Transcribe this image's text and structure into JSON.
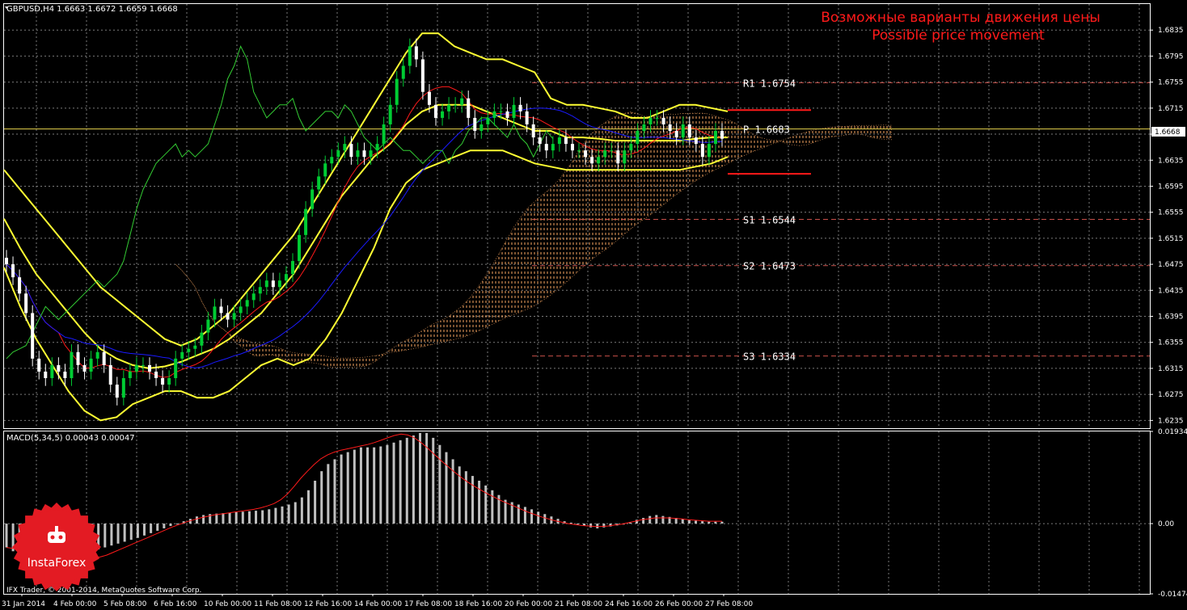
{
  "window": {
    "title": "GBPUSD,H4  1.6663 1.6672 1.6659 1.6668",
    "footer": "IFX Trader, © 2001-2014, MetaQuotes Software Corp."
  },
  "logo": {
    "text": "InstaForex"
  },
  "annotation": {
    "line1": "Возможные варианты движения цены",
    "line2": "Possible price movement",
    "color": "#ff1a1a"
  },
  "colors": {
    "background": "#000000",
    "grid": "#7a7a7a",
    "axis": "#ffffff",
    "candle_up": "#00cc33",
    "candle_down": "#ffffff",
    "bollinger": "#ffff33",
    "tenkan": "#ff1a1a",
    "kijun": "#1a1aff",
    "chikou": "#33cc33",
    "cloud": "#f4a460",
    "pivot_r": "#ff1a1a",
    "pivot_s": "#c8504a",
    "macd_hist": "#c0c0c0",
    "macd_signal": "#ff1a1a",
    "current_price": "#e8d44d"
  },
  "chart_data": [
    {
      "type": "candlestick",
      "symbol": "GBPUSD",
      "timeframe": "H4",
      "ohlc_current": {
        "open": 1.6663,
        "high": 1.6672,
        "low": 1.6659,
        "close": 1.6668
      },
      "current_price_label": "1.6668",
      "ylim": [
        1.6223,
        1.6875
      ],
      "y_ticks": [
        "1.6835",
        "1.6795",
        "1.6755",
        "1.6715",
        "1.6675",
        "1.6635",
        "1.6595",
        "1.6555",
        "1.6515",
        "1.6475",
        "1.6435",
        "1.6395",
        "1.6355",
        "1.6315",
        "1.6275",
        "1.6235"
      ],
      "x_ticks": [
        "31 Jan 2014",
        "4 Feb 00:00",
        "5 Feb 08:00",
        "6 Feb 16:00",
        "10 Feb 00:00",
        "11 Feb 08:00",
        "12 Feb 16:00",
        "14 Feb 00:00",
        "17 Feb 08:00",
        "18 Feb 16:00",
        "20 Feb 00:00",
        "21 Feb 08:00",
        "24 Feb 16:00",
        "26 Feb 00:00",
        "27 Feb 08:00"
      ],
      "pivot_levels": [
        {
          "label": "R1  1.6754",
          "value": 1.6754
        },
        {
          "label": "P  1.6683",
          "value": 1.6683
        },
        {
          "label": "S1  1.6544",
          "value": 1.6544
        },
        {
          "label": "S2  1.6473",
          "value": 1.6473
        },
        {
          "label": "S3  1.6334",
          "value": 1.6334
        }
      ],
      "closes": [
        1.6475,
        1.6455,
        1.643,
        1.64,
        1.633,
        1.631,
        1.63,
        1.632,
        1.631,
        1.63,
        1.634,
        1.632,
        1.631,
        1.633,
        1.634,
        1.632,
        1.629,
        1.627,
        1.63,
        1.631,
        1.632,
        1.632,
        1.631,
        1.63,
        1.629,
        1.63,
        1.633,
        1.634,
        1.6345,
        1.635,
        1.637,
        1.639,
        1.641,
        1.64,
        1.639,
        1.64,
        1.641,
        1.642,
        1.643,
        1.644,
        1.645,
        1.644,
        1.645,
        1.646,
        1.648,
        1.652,
        1.656,
        1.659,
        1.661,
        1.663,
        1.664,
        1.665,
        1.666,
        1.664,
        1.665,
        1.664,
        1.665,
        1.666,
        1.669,
        1.672,
        1.676,
        1.678,
        1.681,
        1.679,
        1.674,
        1.672,
        1.67,
        1.671,
        1.672,
        1.672,
        1.673,
        1.67,
        1.668,
        1.669,
        1.67,
        1.671,
        1.671,
        1.67,
        1.672,
        1.671,
        1.669,
        1.667,
        1.666,
        1.665,
        1.666,
        1.667,
        1.666,
        1.665,
        1.665,
        1.664,
        1.663,
        1.664,
        1.665,
        1.665,
        1.663,
        1.665,
        1.666,
        1.668,
        1.669,
        1.67,
        1.67,
        1.669,
        1.668,
        1.667,
        1.669,
        1.667,
        1.666,
        1.664,
        1.666,
        1.668,
        1.6668
      ],
      "bollinger_upper": [
        1.662,
        1.659,
        1.656,
        1.653,
        1.65,
        1.647,
        1.644,
        1.642,
        1.64,
        1.638,
        1.636,
        1.635,
        1.636,
        1.638,
        1.64,
        1.643,
        1.646,
        1.649,
        1.652,
        1.656,
        1.66,
        1.664,
        1.668,
        1.672,
        1.676,
        1.68,
        1.683,
        1.683,
        1.681,
        1.68,
        1.679,
        1.679,
        1.678,
        1.677,
        1.673,
        1.672,
        1.672,
        1.6715,
        1.671,
        1.67,
        1.67,
        1.671,
        1.672,
        1.672,
        1.6715,
        1.671
      ],
      "bollinger_middle": [
        1.6545,
        1.65,
        1.646,
        1.643,
        1.64,
        1.637,
        1.6345,
        1.633,
        1.632,
        1.6315,
        1.6318,
        1.6325,
        1.6335,
        1.6345,
        1.636,
        1.638,
        1.64,
        1.643,
        1.646,
        1.65,
        1.654,
        1.658,
        1.661,
        1.664,
        1.666,
        1.669,
        1.671,
        1.672,
        1.672,
        1.672,
        1.671,
        1.67,
        1.669,
        1.668,
        1.668,
        1.667,
        1.667,
        1.6668,
        1.6665,
        1.6665,
        1.6665,
        1.6665,
        1.6665,
        1.6668,
        1.667,
        1.667
      ],
      "bollinger_lower": [
        1.647,
        1.641,
        1.636,
        1.632,
        1.628,
        1.625,
        1.6235,
        1.624,
        1.626,
        1.627,
        1.628,
        1.628,
        1.627,
        1.627,
        1.628,
        1.63,
        1.632,
        1.633,
        1.632,
        1.633,
        1.636,
        1.64,
        1.645,
        1.65,
        1.656,
        1.66,
        1.662,
        1.663,
        1.664,
        1.665,
        1.665,
        1.665,
        1.664,
        1.663,
        1.6625,
        1.662,
        1.662,
        1.662,
        1.662,
        1.662,
        1.662,
        1.662,
        1.662,
        1.6625,
        1.663,
        1.664
      ],
      "macd": {
        "title": "MACD(5,34,5) 0.00043 0.00047",
        "ylim": [
          -0.01474,
          0.01934
        ],
        "y_ticks": [
          "0.01934",
          "0.00",
          "-0.01474"
        ],
        "histogram": [
          -0.005,
          -0.0058,
          -0.0065,
          -0.0072,
          -0.0078,
          -0.0083,
          -0.0085,
          -0.0082,
          -0.0078,
          -0.0074,
          -0.007,
          -0.0066,
          -0.0062,
          -0.0058,
          -0.0054,
          -0.005,
          -0.0046,
          -0.0042,
          -0.0038,
          -0.0034,
          -0.003,
          -0.0025,
          -0.002,
          -0.0015,
          -0.001,
          -0.0005,
          0.0,
          0.0005,
          0.001,
          0.0015,
          0.0018,
          0.002,
          0.0021,
          0.0022,
          0.0023,
          0.0024,
          0.0025,
          0.0026,
          0.0027,
          0.0028,
          0.003,
          0.0033,
          0.0036,
          0.004,
          0.0045,
          0.0055,
          0.007,
          0.009,
          0.011,
          0.0125,
          0.0135,
          0.0145,
          0.015,
          0.0155,
          0.016,
          0.016,
          0.016,
          0.0162,
          0.0165,
          0.017,
          0.0175,
          0.018,
          0.0185,
          0.019,
          0.019,
          0.018,
          0.0165,
          0.015,
          0.0135,
          0.012,
          0.011,
          0.01,
          0.009,
          0.008,
          0.007,
          0.006,
          0.005,
          0.0045,
          0.004,
          0.0035,
          0.003,
          0.0025,
          0.002,
          0.0015,
          0.001,
          0.0005,
          0.0002,
          -0.0002,
          -0.0005,
          -0.0008,
          -0.001,
          -0.0008,
          -0.0006,
          -0.0004,
          -0.0002,
          0.0002,
          0.0008,
          0.0012,
          0.0016,
          0.0018,
          0.0016,
          0.0014,
          0.0012,
          0.001,
          0.0008,
          0.0006,
          0.0005,
          0.0004,
          0.0004,
          0.0004
        ],
        "signal": [
          -0.005,
          -0.0052,
          -0.0054,
          -0.0056,
          -0.0058,
          -0.006,
          -0.0062,
          -0.0064,
          -0.0066,
          -0.0068,
          -0.007,
          -0.0072,
          -0.0073,
          -0.0072,
          -0.007,
          -0.0066,
          -0.006,
          -0.0054,
          -0.0048,
          -0.0042,
          -0.0036,
          -0.003,
          -0.0024,
          -0.0018,
          -0.0012,
          -0.0006,
          -0.0001,
          0.0004,
          0.0008,
          0.0012,
          0.0015,
          0.0018,
          0.002,
          0.0022,
          0.0024,
          0.0026,
          0.0028,
          0.003,
          0.0033,
          0.0037,
          0.0042,
          0.005,
          0.0062,
          0.0078,
          0.0095,
          0.011,
          0.0124,
          0.0136,
          0.0144,
          0.015,
          0.0154,
          0.0157,
          0.016,
          0.0163,
          0.0166,
          0.017,
          0.0175,
          0.018,
          0.0185,
          0.0188,
          0.0186,
          0.018,
          0.017,
          0.0158,
          0.0145,
          0.0132,
          0.012,
          0.0108,
          0.0097,
          0.0087,
          0.0078,
          0.007,
          0.0062,
          0.0055,
          0.0048,
          0.0042,
          0.0036,
          0.003,
          0.0024,
          0.0019,
          0.0014,
          0.001,
          0.0006,
          0.0003,
          0.0,
          -0.0002,
          -0.0004,
          -0.0005,
          -0.0006,
          -0.0006,
          -0.0005,
          -0.0003,
          -0.0001,
          0.0002,
          0.0005,
          0.0008,
          0.001,
          0.0012,
          0.0012,
          0.0012,
          0.0011,
          0.001,
          0.0008,
          0.0007,
          0.0006,
          0.0005,
          0.0005,
          0.0005
        ]
      }
    }
  ]
}
